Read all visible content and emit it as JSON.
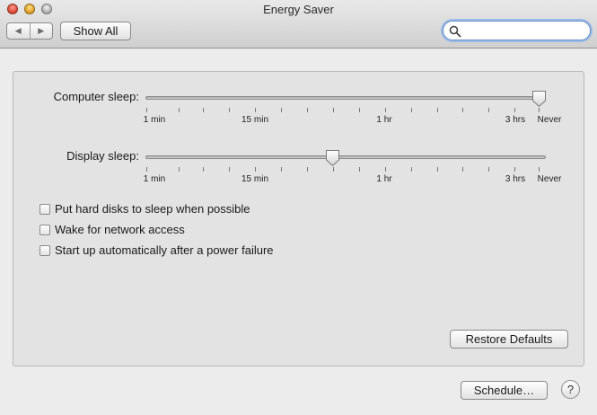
{
  "window": {
    "title": "Energy Saver"
  },
  "toolbar": {
    "back_glyph": "◀",
    "forward_glyph": "▶",
    "show_all_label": "Show All",
    "search": {
      "value": "",
      "placeholder": ""
    }
  },
  "sliders": [
    {
      "label": "Computer sleep:",
      "value": "Never",
      "ticks": [
        "1 min",
        "15 min",
        "1 hr",
        "3 hrs",
        "Never"
      ]
    },
    {
      "label": "Display sleep:",
      "value": "~45 min",
      "ticks": [
        "1 min",
        "15 min",
        "1 hr",
        "3 hrs",
        "Never"
      ]
    }
  ],
  "options": [
    {
      "label": "Put hard disks to sleep when possible",
      "checked": false
    },
    {
      "label": "Wake for network access",
      "checked": false
    },
    {
      "label": "Start up automatically after a power failure",
      "checked": false
    }
  ],
  "buttons": {
    "restore_defaults": "Restore Defaults",
    "schedule": "Schedule…",
    "help": "?"
  },
  "colors": {
    "search_focus": "#9bbbe6"
  }
}
